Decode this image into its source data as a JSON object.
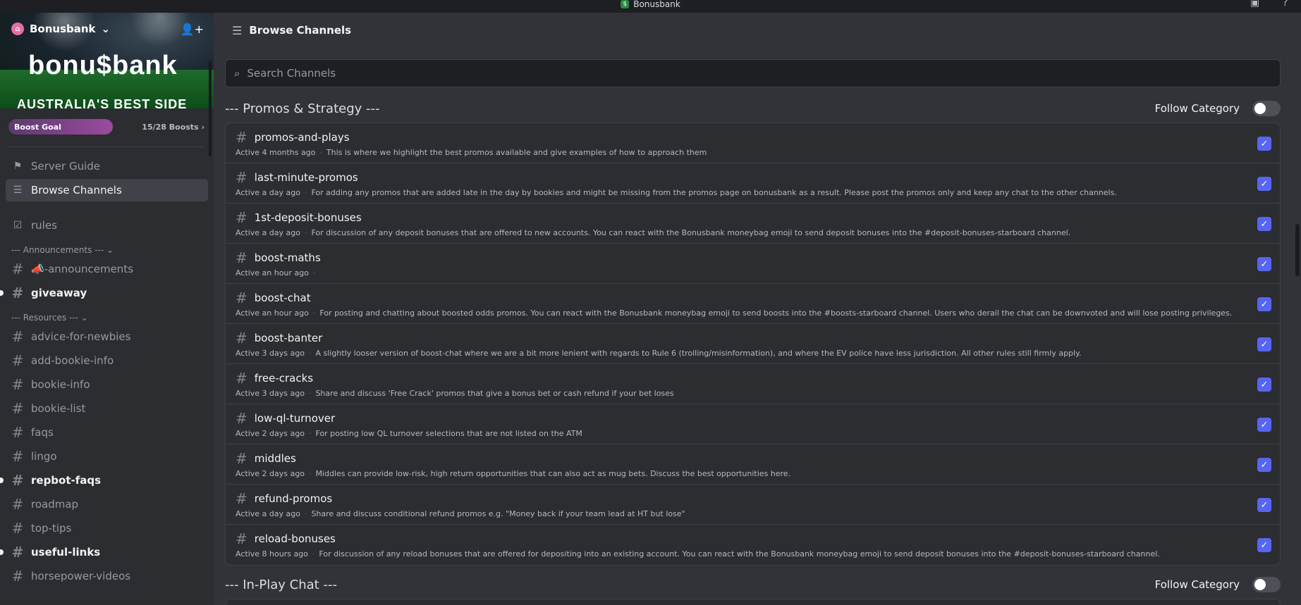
{
  "app": {
    "title": "Bonusbank"
  },
  "server": {
    "name": "Bonusbank",
    "logo_text": "bonu$bank",
    "tagline": "AUSTRALIA'S BEST SIDE HUSTLE",
    "boost_goal_label": "Boost Goal",
    "boost_count": "15/28 Boosts",
    "boost_progress": 0.536
  },
  "sidebar": {
    "top_items": [
      {
        "label": "Server Guide",
        "icon": "signpost-icon"
      },
      {
        "label": "Browse Channels",
        "icon": "browse-channels-icon"
      }
    ],
    "rules": "rules",
    "category_announcements": "--- Announcements ---",
    "announcements": [
      {
        "label": "📣-announcements",
        "unread": false
      },
      {
        "label": "giveaway",
        "unread": true
      }
    ],
    "category_resources": "--- Resources ---",
    "resources": [
      {
        "label": "advice-for-newbies",
        "unread": false
      },
      {
        "label": "add-bookie-info",
        "unread": false
      },
      {
        "label": "bookie-info",
        "unread": false
      },
      {
        "label": "bookie-list",
        "unread": false
      },
      {
        "label": "faqs",
        "unread": false
      },
      {
        "label": "lingo",
        "unread": false
      },
      {
        "label": "repbot-faqs",
        "unread": true
      },
      {
        "label": "roadmap",
        "unread": false
      },
      {
        "label": "top-tips",
        "unread": false
      },
      {
        "label": "useful-links",
        "unread": true
      },
      {
        "label": "horsepower-videos",
        "unread": false
      }
    ]
  },
  "main": {
    "header": "Browse Channels",
    "search_placeholder": "Search Channels",
    "follow_label": "Follow Category",
    "categories": [
      {
        "title": "--- Promos & Strategy ---"
      },
      {
        "title": "--- In-Play Chat ---"
      }
    ],
    "channels": [
      {
        "name": "promos-and-plays",
        "active": "Active 4 months ago",
        "desc": "This is where we highlight the best promos available and give examples of how to approach them"
      },
      {
        "name": "last-minute-promos",
        "active": "Active a day ago",
        "desc": "For adding any promos that are added late in the day by bookies and might be missing from the promos page on bonusbank as a result. Please post the promos only and keep any chat to the other channels."
      },
      {
        "name": "1st-deposit-bonuses",
        "active": "Active a day ago",
        "desc": "For discussion of any deposit bonuses that are offered to new accounts. You can react with the Bonusbank moneybag emoji to send deposit bonuses into the #deposit-bonuses-starboard channel."
      },
      {
        "name": "boost-maths",
        "active": "Active an hour ago",
        "desc": ""
      },
      {
        "name": "boost-chat",
        "active": "Active an hour ago",
        "desc": "For posting and chatting about boosted odds promos. You can react with the Bonusbank moneybag emoji to send boosts into the #boosts-starboard channel. Users who derail the chat can be downvoted and will lose posting privileges."
      },
      {
        "name": "boost-banter",
        "active": "Active 3 days ago",
        "desc": "A slightly looser version of boost-chat where we are a bit more lenient with regards to Rule 6 (trolling/misinformation), and where the EV police have less jurisdiction. All other rules still firmly apply."
      },
      {
        "name": "free-cracks",
        "active": "Active 3 days ago",
        "desc": "Share and discuss 'Free Crack' promos that give a bonus bet or cash refund if your bet loses"
      },
      {
        "name": "low-ql-turnover",
        "active": "Active 2 days ago",
        "desc": "For posting low QL turnover selections that are not listed on the ATM"
      },
      {
        "name": "middles",
        "active": "Active 2 days ago",
        "desc": "Middles can provide low-risk, high return opportunities that can also act as mug bets. Discuss the best opportunities here."
      },
      {
        "name": "refund-promos",
        "active": "Active a day ago",
        "desc": "Share and discuss conditional refund promos e.g. \"Money back if your team lead at HT but lose\""
      },
      {
        "name": "reload-bonuses",
        "active": "Active 8 hours ago",
        "desc": "For discussion of any reload bonuses that are offered for depositing into an existing account. You can react with the Bonusbank moneybag emoji to send deposit bonuses into the #deposit-bonuses-starboard channel."
      }
    ]
  },
  "colors": {
    "accent": "#5865f2",
    "background": "#313338",
    "sidebar": "#2b2d31"
  }
}
